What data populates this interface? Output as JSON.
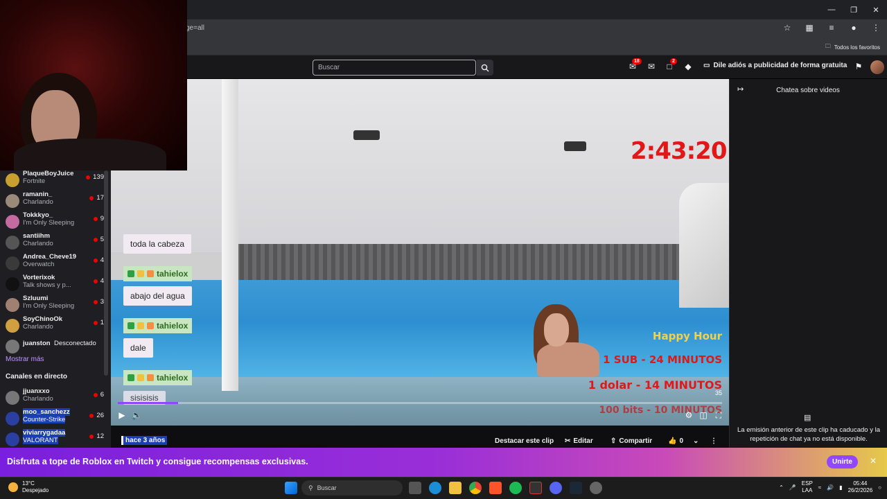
{
  "browser": {
    "url_fragment": "ge=all",
    "favorites_label": "Todos los favoritos"
  },
  "topnav": {
    "search_placeholder": "Buscar",
    "inbox_badge": "18",
    "notif_badge": "2",
    "promo_text": "Dile adiós a publicidad de forma gratuita"
  },
  "sidebar": {
    "followed": [
      {
        "name": "PlaqueBoyJuice",
        "game": "Fortnite",
        "viewers": "139",
        "color": "#c8a030"
      },
      {
        "name": "ramanin_",
        "game": "Charlando",
        "viewers": "17",
        "color": "#9a8a7a"
      },
      {
        "name": "Tokkkyo_",
        "game": "I'm Only Sleeping",
        "viewers": "9",
        "color": "#c46aa0"
      },
      {
        "name": "santiihm",
        "game": "Charlando",
        "viewers": "5",
        "color": "#555"
      },
      {
        "name": "Andrea_Cheve19",
        "game": "Overwatch",
        "viewers": "4",
        "color": "#3a3a3a"
      },
      {
        "name": "Vorterixok",
        "game": "Talk shows y p...",
        "viewers": "4",
        "color": "#111"
      },
      {
        "name": "Szluumi",
        "game": "I'm Only Sleeping",
        "viewers": "3",
        "color": "#a08070"
      },
      {
        "name": "SoyChinoOk",
        "game": "Charlando",
        "viewers": "1",
        "color": "#d0a040"
      }
    ],
    "offline": {
      "name": "juanston",
      "status": "Desconectado"
    },
    "show_more": "Mostrar más",
    "live_header": "Canales en directo",
    "live": [
      {
        "name": "jjuanxxo",
        "game": "Charlando",
        "viewers": "6",
        "color": "#777"
      },
      {
        "name": "moo_sanchezz",
        "game": "Counter-Strike",
        "viewers": "26",
        "color": "#2a3fa0"
      },
      {
        "name": "viviarrygadaa",
        "game": "VALORANT",
        "viewers": "12",
        "color": "#2a3fa0"
      }
    ]
  },
  "video": {
    "timer": "2:43:20",
    "overlay_lines": [
      "Happy Hour",
      "1 SUB - 24 MINUTOS",
      "1 dolar - 14 MINUTOS",
      "100 bits - 10 MINUTOS"
    ],
    "chat_overlay": {
      "msg1": "toda la cabeza",
      "user": "tahielox",
      "msg2": "abajo del agua",
      "msg3": "dale",
      "msg4": "sisisisis"
    },
    "count": "35",
    "progress_fraction": 0.1
  },
  "below": {
    "ago": "hace 3 años",
    "highlight_btn": "Destacar este clip",
    "edit_btn": "Editar",
    "share_btn": "Compartir",
    "likes": "0"
  },
  "chat": {
    "title": "Chatea sobre videos",
    "note": "La emisión anterior de este clip ha caducado y la repetición de chat ya no está disponible."
  },
  "banner": {
    "text": "Disfruta a tope de Roblox en Twitch y consigue recompensas exclusivas.",
    "join": "Unirte"
  },
  "taskbar": {
    "temp": "13°C",
    "weather": "Despejado",
    "search": "Buscar",
    "lang1": "ESP",
    "lang2": "LAA",
    "time": "05:44",
    "date": "26/2/2026"
  }
}
